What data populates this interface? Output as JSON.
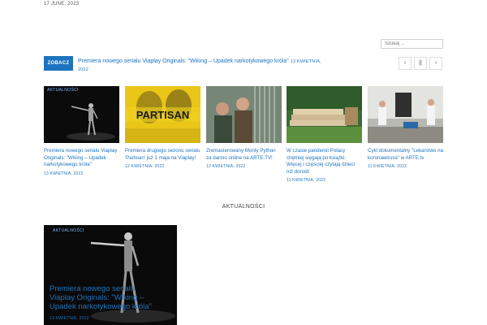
{
  "header": {
    "date": "17 JUNE, 2023",
    "search_placeholder": "Szukaj ..."
  },
  "ticker": {
    "button_label": "ZOBACZ",
    "headline": "Premiera nowego serialu Viaplay Originals: \"Wiking – Upadek narkotykowego króla\"",
    "date": "13 KWIETNIA, 2022",
    "controls": [
      "‹",
      "||",
      "›"
    ]
  },
  "cards": [
    {
      "category": "AKTUALNOŚCI",
      "title": "Premiera nowego serialu Viaplay Originals: \"Wiking – Upadek narkotykowego króla\"",
      "date": "13 KWIETNIA, 2022",
      "image": "dancer"
    },
    {
      "category": "",
      "title": "Premiera drugiego sezonu serialu 'Partisan' już 1 maja na Viaplay!",
      "date": "12 KWIETNIA, 2022",
      "image": "partisan-poster"
    },
    {
      "category": "",
      "title": "Zremasterowany Monty Python za darmo online na ARTE.TV!",
      "date": "12 KWIETNIA, 2022",
      "image": "monty-python"
    },
    {
      "category": "",
      "title": "W czasie pandemii Polacy chętniej sięgają po książki. Więcej i częściej czytają dzieci niż dorośli",
      "date": "11 KWIETNIA, 2022",
      "image": "books"
    },
    {
      "category": "",
      "title": "Cykl dokumentalny \"Lekarstwo na koronawirusa\" w ARTE.tv",
      "date": "11 KWIETNIA, 2022",
      "image": "documentary"
    }
  ],
  "section": {
    "heading": "AKTUALNOŚCI"
  },
  "feature": {
    "category": "AKTUALNOŚCI",
    "title": "Premiera nowego serialu Viaplay Originals: \"Wiking – Upadek narkotykowego króla\"",
    "date": "13 KWIETNIA, 2022"
  }
}
